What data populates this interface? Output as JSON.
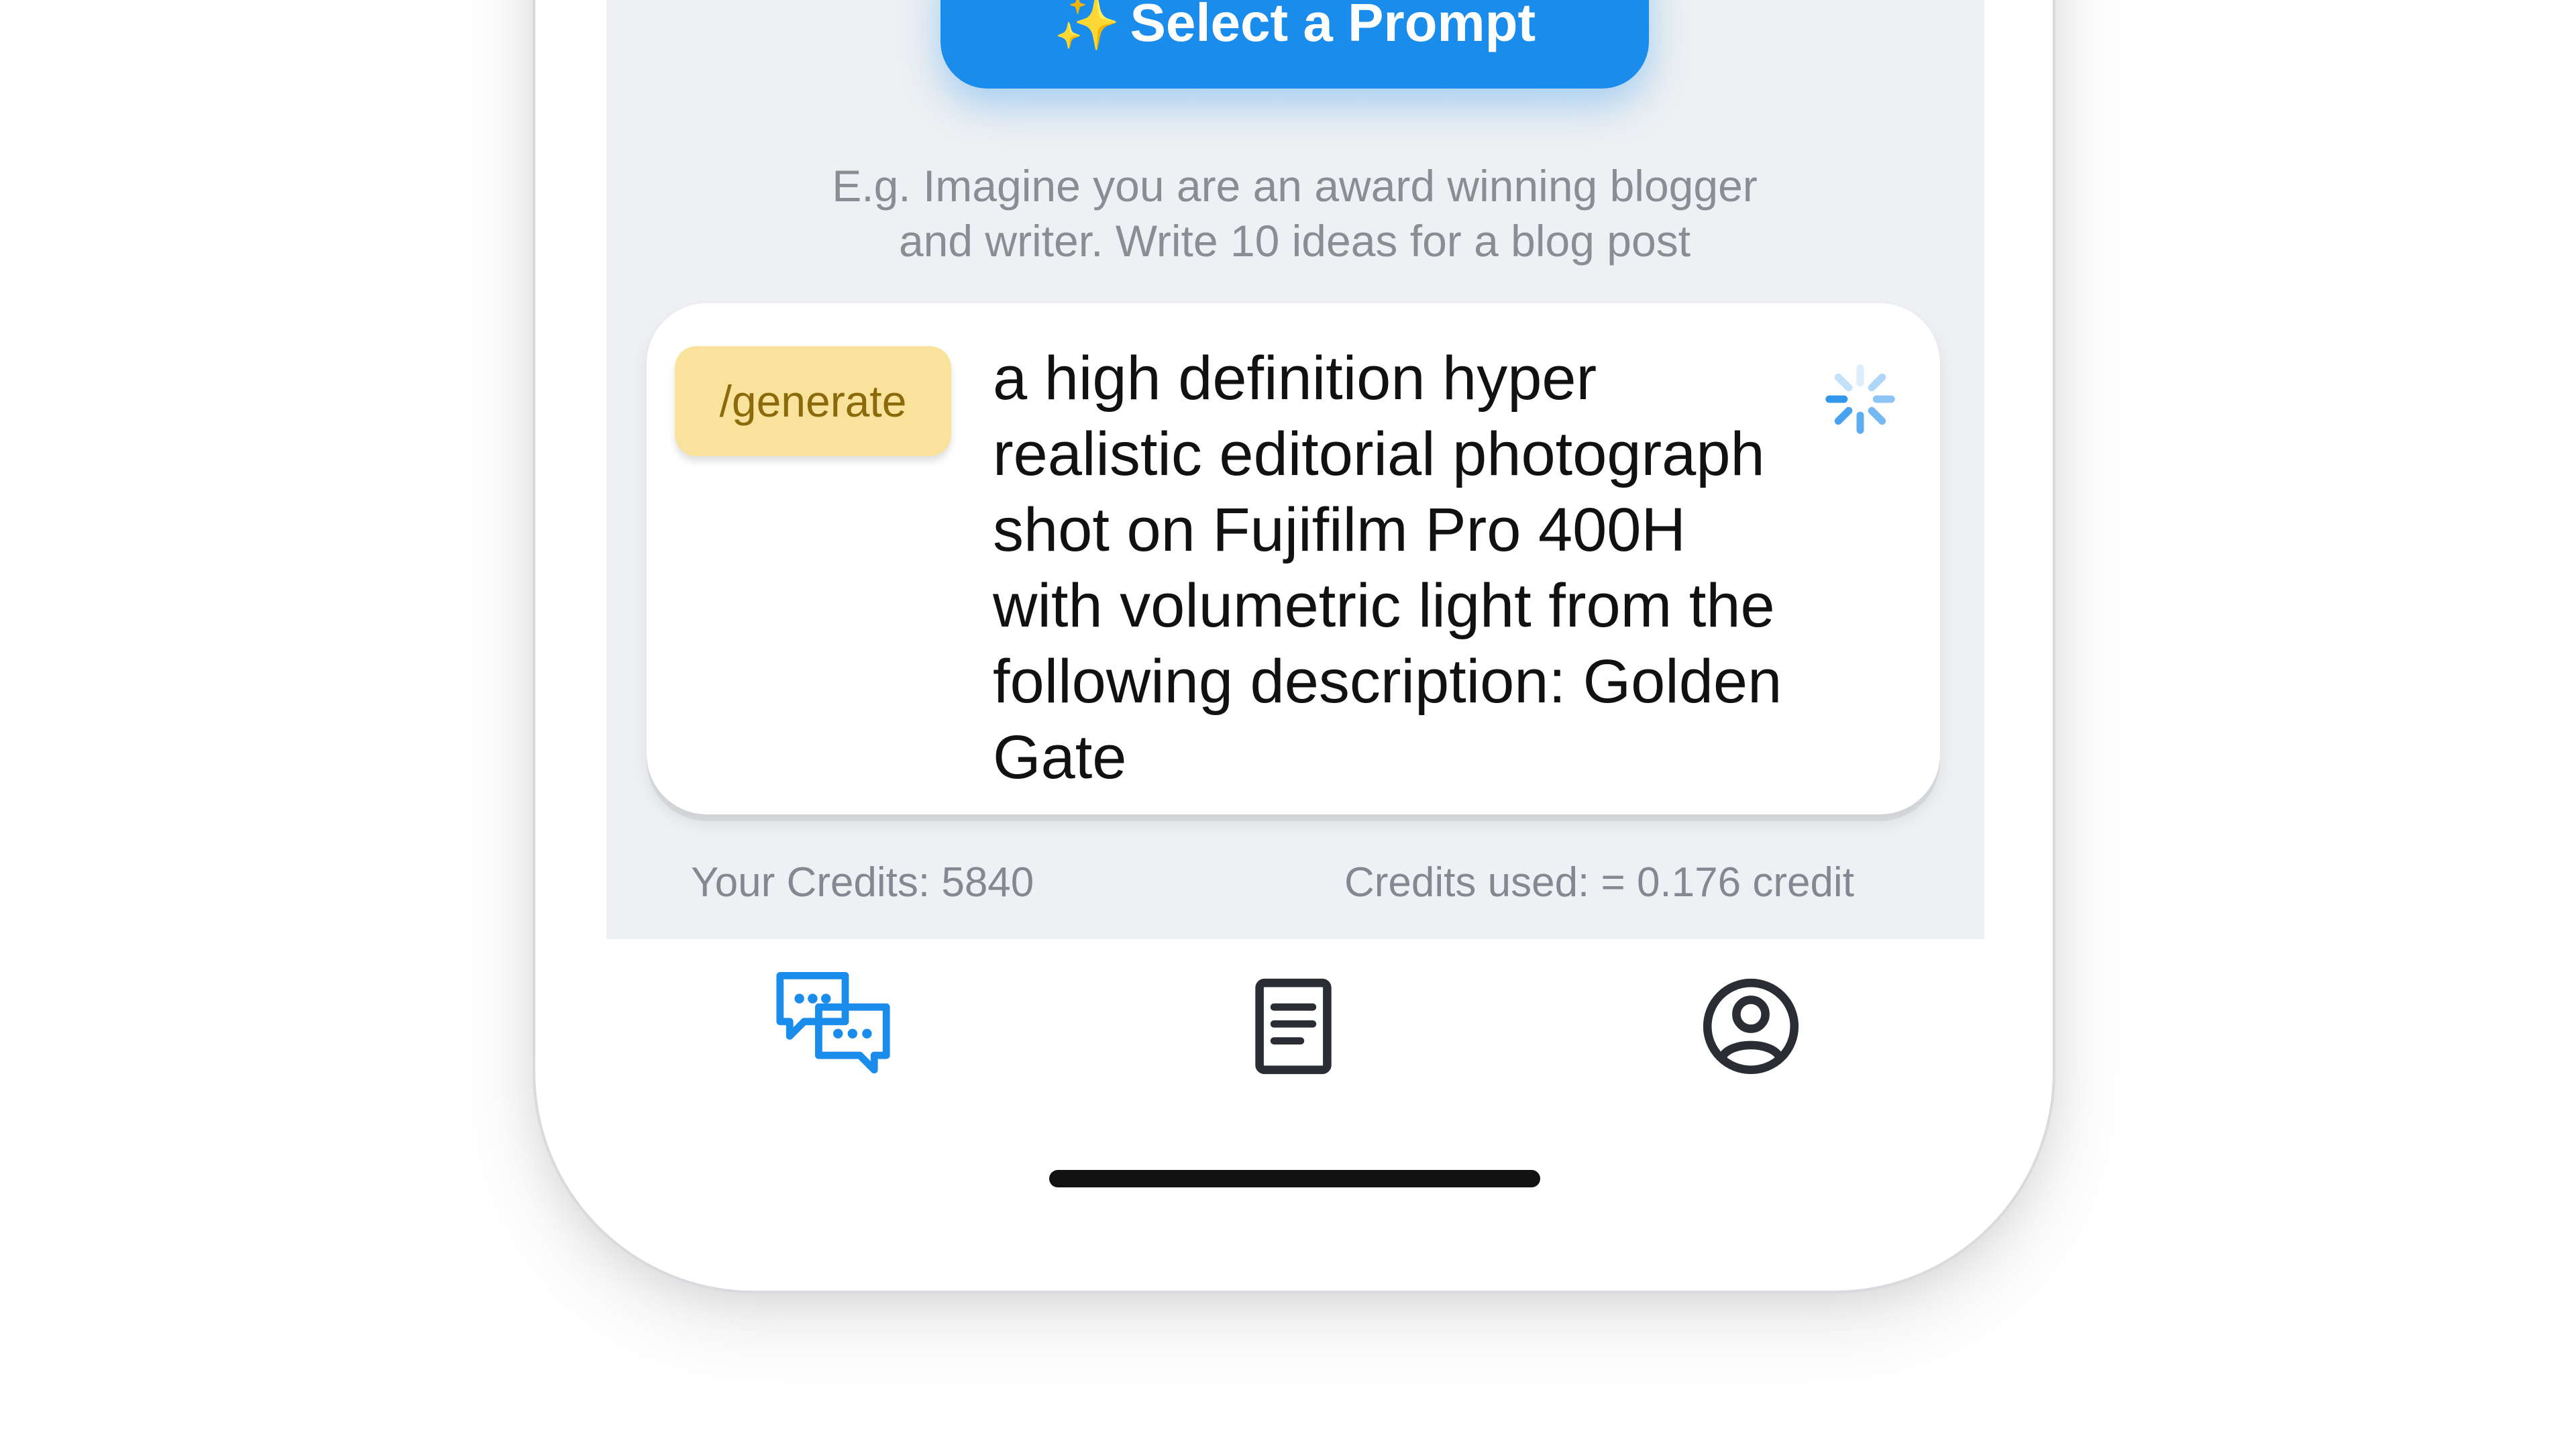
{
  "prompt_button": {
    "icon": "✨",
    "label": "Select a Prompt"
  },
  "example": {
    "line1": "E.g. Imagine you are an award winning blogger",
    "line2": "and writer. Write 10 ideas for a blog post"
  },
  "composer": {
    "command": "/generate",
    "text": "a high definition hyper realistic editorial photograph shot on Fujifilm Pro 400H with volumetric light from the following description: Golden Gate"
  },
  "credits": {
    "available": "Your Credits: 5840",
    "used": "Credits used: = 0.176 credit"
  },
  "tabbar": {
    "items": [
      {
        "icon": "chat-bubbles-icon",
        "active": true
      },
      {
        "icon": "document-icon",
        "active": false
      },
      {
        "icon": "profile-icon",
        "active": false
      }
    ]
  },
  "colors": {
    "accent": "#1a8cec",
    "chip": "#f9e39c",
    "screen_bg": "#eef0f3"
  }
}
